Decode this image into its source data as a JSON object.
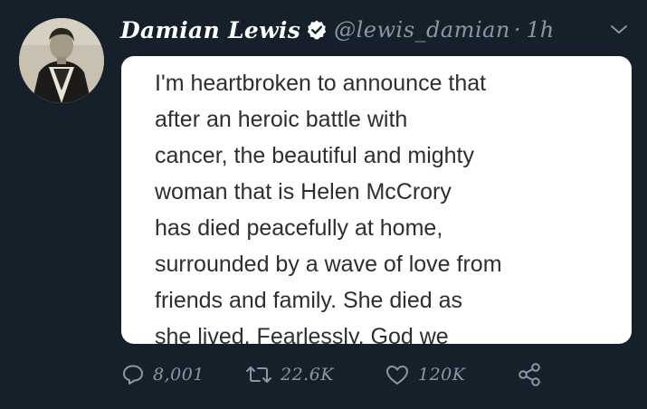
{
  "tweet": {
    "display_name": "Damian Lewis",
    "verified": true,
    "handle": "@lewis_damian",
    "separator": "·",
    "time": "1h",
    "avatar": "avatar-photo",
    "menu_icon": "chevron-down-icon",
    "image_text_lines": [
      "I'm heartbroken to announce that",
      "after an heroic battle with",
      "cancer, the beautiful and mighty",
      "woman that is Helen McCrory",
      "has died peacefully at home,",
      "surrounded by a wave of love from",
      "friends and family. She died as",
      "she lived. Fearlessly. God we"
    ]
  },
  "actions": {
    "reply": {
      "icon": "reply-icon",
      "count": "8,001"
    },
    "retweet": {
      "icon": "retweet-icon",
      "count": "22.6K"
    },
    "like": {
      "icon": "heart-icon",
      "count": "120K"
    },
    "share": {
      "icon": "share-icon"
    }
  },
  "colors": {
    "background": "#15202b",
    "primary_text": "#ffffff",
    "secondary_text": "#8899a6",
    "card_background": "#ffffff",
    "card_text": "#2e2e2e"
  }
}
